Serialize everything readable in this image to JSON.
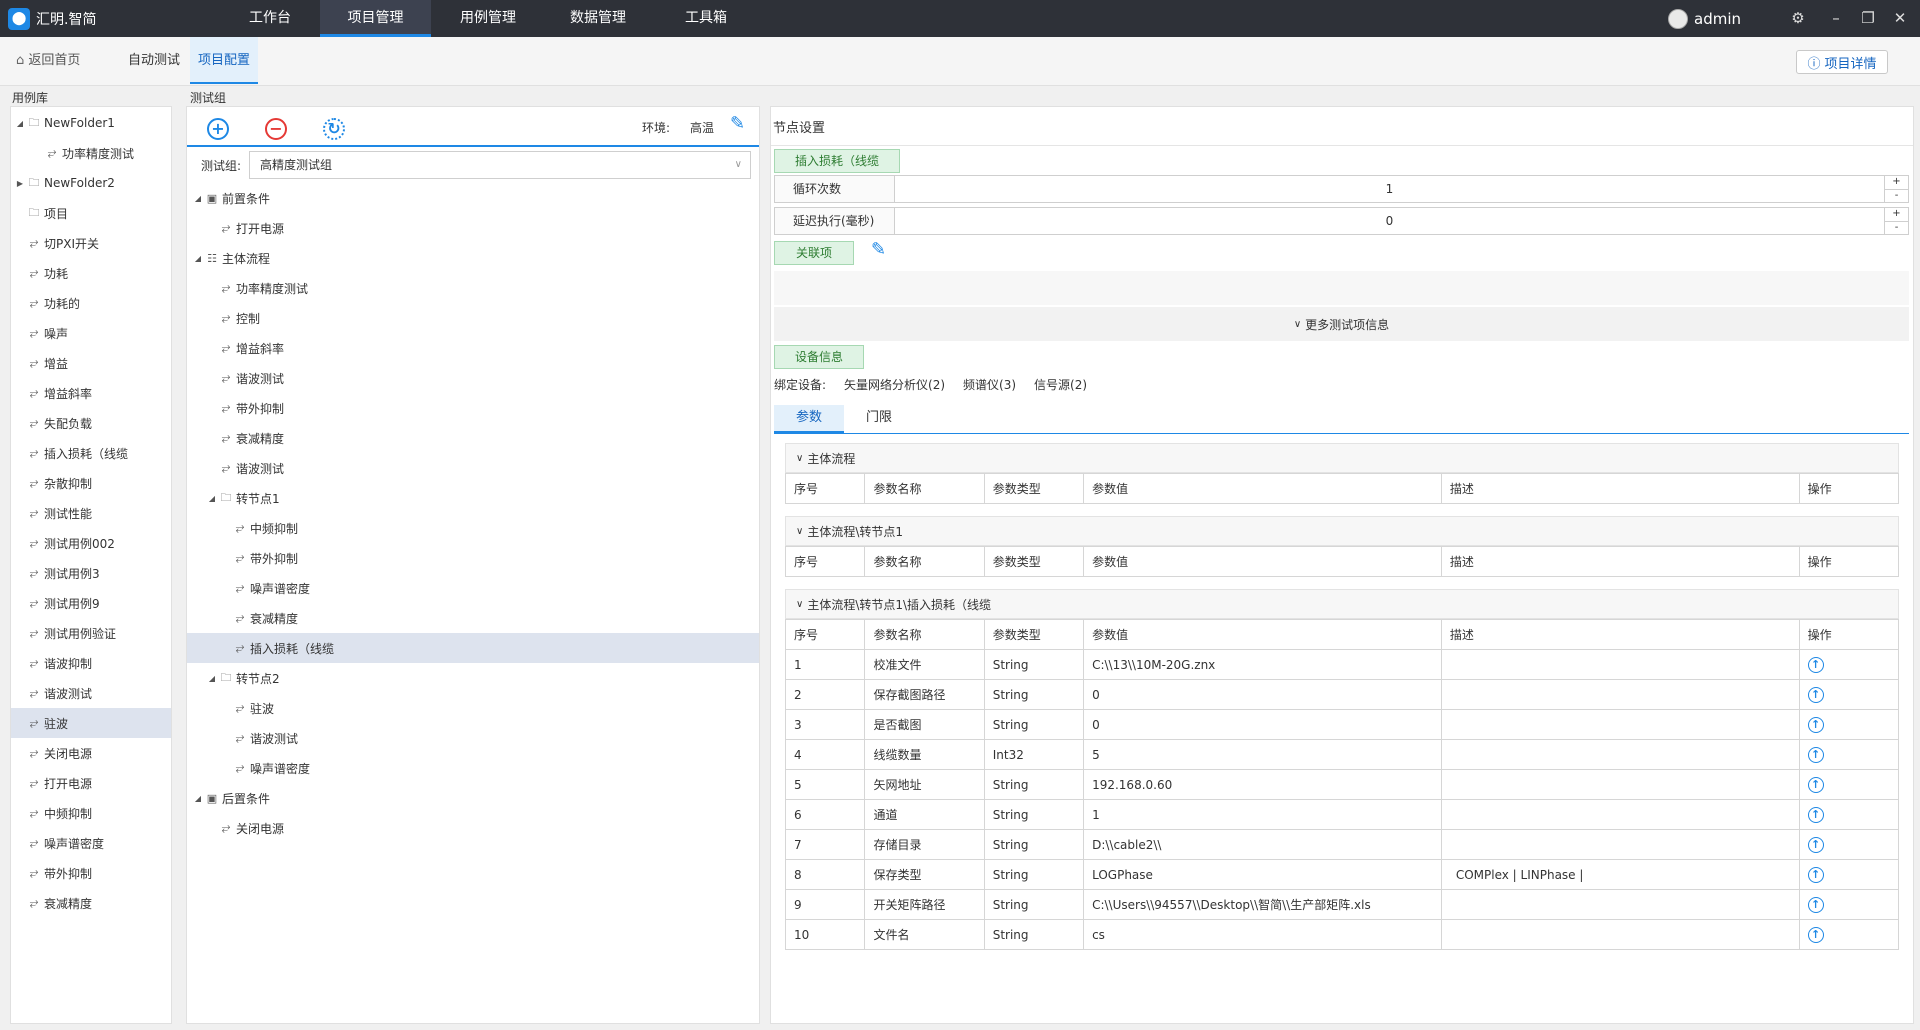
{
  "app": {
    "title": "汇明.智简"
  },
  "nav": {
    "items": [
      {
        "label": "工作台"
      },
      {
        "label": "项目管理"
      },
      {
        "label": "用例管理"
      },
      {
        "label": "数据管理"
      },
      {
        "label": "工具箱"
      }
    ]
  },
  "user": {
    "name": "admin"
  },
  "subnav": {
    "back": "返回首页",
    "auto_test": "自动测试",
    "project_config": "项目配置",
    "detail_button": "项目详情"
  },
  "library": {
    "title": "用例库",
    "items": [
      {
        "label": "NewFolder1",
        "icon": "folder-icon",
        "level": 0,
        "caret": "◢"
      },
      {
        "label": "功率精度测试",
        "icon": "case-icon",
        "level": 1
      },
      {
        "label": "NewFolder2",
        "icon": "folder-icon",
        "level": 0,
        "caret": "▶"
      },
      {
        "label": "项目",
        "icon": "folder-icon",
        "level": 0
      },
      {
        "label": "切PXI开关",
        "icon": "case-icon",
        "level": 0
      },
      {
        "label": "功耗",
        "icon": "case-icon",
        "level": 0
      },
      {
        "label": "功耗的",
        "icon": "case-icon",
        "level": 0
      },
      {
        "label": "噪声",
        "icon": "case-icon",
        "level": 0
      },
      {
        "label": "增益",
        "icon": "case-icon",
        "level": 0
      },
      {
        "label": "增益斜率",
        "icon": "case-icon",
        "level": 0
      },
      {
        "label": "失配负载",
        "icon": "case-icon",
        "level": 0
      },
      {
        "label": "插入损耗（线缆",
        "icon": "case-icon",
        "level": 0
      },
      {
        "label": "杂散抑制",
        "icon": "case-icon",
        "level": 0
      },
      {
        "label": "测试性能",
        "icon": "case-icon",
        "level": 0
      },
      {
        "label": "测试用例002",
        "icon": "case-icon",
        "level": 0
      },
      {
        "label": "测试用例3",
        "icon": "case-icon",
        "level": 0
      },
      {
        "label": "测试用例9",
        "icon": "case-icon",
        "level": 0
      },
      {
        "label": "测试用例验证",
        "icon": "case-icon",
        "level": 0
      },
      {
        "label": "谐波抑制",
        "icon": "case-icon",
        "level": 0
      },
      {
        "label": "谐波测试",
        "icon": "case-icon",
        "level": 0
      },
      {
        "label": "驻波",
        "icon": "case-icon",
        "level": 0,
        "selected": true
      },
      {
        "label": "关闭电源",
        "icon": "case-icon",
        "level": 0
      },
      {
        "label": "打开电源",
        "icon": "case-icon",
        "level": 0
      },
      {
        "label": "中频抑制",
        "icon": "case-icon",
        "level": 0
      },
      {
        "label": "噪声谱密度",
        "icon": "case-icon",
        "level": 0
      },
      {
        "label": "带外抑制",
        "icon": "case-icon",
        "level": 0
      },
      {
        "label": "衰减精度",
        "icon": "case-icon",
        "level": 0
      }
    ]
  },
  "testgroup": {
    "title": "测试组",
    "env_label": "环境:",
    "env_value": "高温",
    "group_label": "测试组:",
    "group_value": "高精度测试组",
    "tree": [
      {
        "label": "前置条件",
        "icon": "group-icon",
        "level": 0,
        "caret": "◢"
      },
      {
        "label": "打开电源",
        "icon": "case-icon",
        "level": 1
      },
      {
        "label": "主体流程",
        "icon": "table-icon",
        "level": 0,
        "caret": "◢"
      },
      {
        "label": "功率精度测试",
        "icon": "case-icon",
        "level": 1
      },
      {
        "label": "控制",
        "icon": "case-icon",
        "level": 1
      },
      {
        "label": "增益斜率",
        "icon": "case-icon",
        "level": 1
      },
      {
        "label": "谐波测试",
        "icon": "case-icon",
        "level": 1
      },
      {
        "label": "带外抑制",
        "icon": "case-icon",
        "level": 1
      },
      {
        "label": "衰减精度",
        "icon": "case-icon",
        "level": 1
      },
      {
        "label": "谐波测试",
        "icon": "case-icon",
        "level": 1
      },
      {
        "label": "转节点1",
        "icon": "folder-icon",
        "level": 1,
        "caret": "◢"
      },
      {
        "label": "中频抑制",
        "icon": "case-icon",
        "level": 2
      },
      {
        "label": "带外抑制",
        "icon": "case-icon",
        "level": 2
      },
      {
        "label": "噪声谱密度",
        "icon": "case-icon",
        "level": 2
      },
      {
        "label": "衰减精度",
        "icon": "case-icon",
        "level": 2
      },
      {
        "label": "插入损耗（线缆",
        "icon": "case-icon",
        "level": 2,
        "selected": true
      },
      {
        "label": "转节点2",
        "icon": "folder-icon",
        "level": 1,
        "caret": "◢"
      },
      {
        "label": "驻波",
        "icon": "case-icon",
        "level": 2
      },
      {
        "label": "谐波测试",
        "icon": "case-icon",
        "level": 2
      },
      {
        "label": "噪声谱密度",
        "icon": "case-icon",
        "level": 2
      },
      {
        "label": "后置条件",
        "icon": "group-icon",
        "level": 0,
        "caret": "◢"
      },
      {
        "label": "关闭电源",
        "icon": "case-icon",
        "level": 1
      }
    ]
  },
  "node": {
    "title": "节点设置",
    "name_button": "插入损耗（线缆",
    "loop_label": "循环次数",
    "loop_value": "1",
    "delay_label": "延迟执行(毫秒)",
    "delay_value": "0",
    "link_button": "关联项",
    "more_info": "更多测试项信息",
    "device_button": "设备信息",
    "bind_label": "绑定设备:",
    "devices": [
      "矢量网络分析仪(2)",
      "频谱仪(3)",
      "信号源(2)"
    ],
    "tabs": [
      "参数",
      "门限"
    ]
  },
  "param_groups": [
    {
      "title": "主体流程",
      "rows": []
    },
    {
      "title": "主体流程\\转节点1",
      "rows": []
    },
    {
      "title": "主体流程\\转节点1\\插入损耗（线缆",
      "rows": [
        [
          "1",
          "校准文件",
          "String",
          "C:\\\\13\\\\10M-20G.znx",
          ""
        ],
        [
          "2",
          "保存截图路径",
          "String",
          "0",
          ""
        ],
        [
          "3",
          "是否截图",
          "String",
          "0",
          ""
        ],
        [
          "4",
          "线缆数量",
          "Int32",
          "5",
          ""
        ],
        [
          "5",
          "矢网地址",
          "String",
          "192.168.0.60",
          ""
        ],
        [
          "6",
          "通道",
          "String",
          "1",
          ""
        ],
        [
          "7",
          "存储目录",
          "String",
          "D:\\\\cable2\\\\",
          ""
        ],
        [
          "8",
          "保存类型",
          "String",
          "LOGPhase",
          "COMPlex | LINPhase |"
        ],
        [
          "9",
          "开关矩阵路径",
          "String",
          "C:\\\\Users\\\\94557\\\\Desktop\\\\智简\\\\生产部矩阵.xls",
          ""
        ],
        [
          "10",
          "文件名",
          "String",
          "cs",
          ""
        ]
      ]
    }
  ],
  "param_headers": [
    "序号",
    "参数名称",
    "参数类型",
    "参数值",
    "描述",
    "操作"
  ],
  "colors": {
    "accent": "#1e88e5",
    "topbar": "#2e3138",
    "selected_row": "#dde3ee",
    "green_button": "#dff3e4"
  }
}
